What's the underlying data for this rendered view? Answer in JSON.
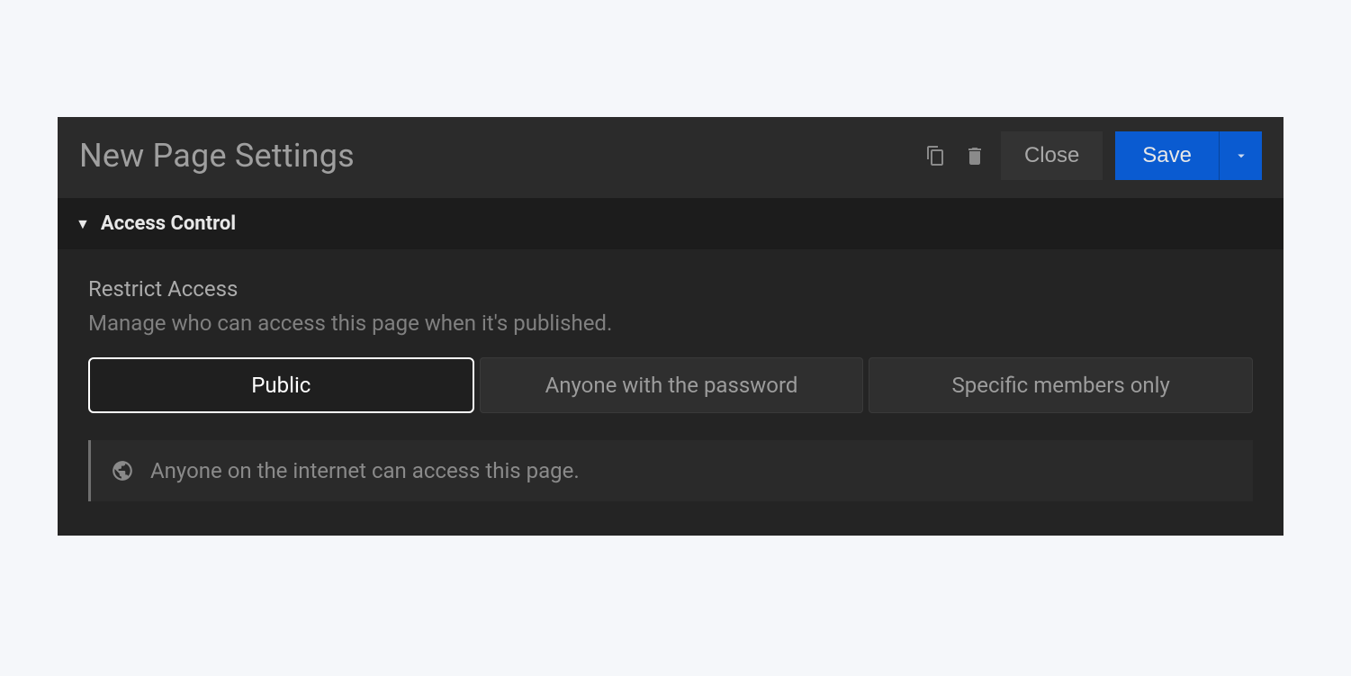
{
  "header": {
    "title": "New Page Settings",
    "close_label": "Close",
    "save_label": "Save"
  },
  "section": {
    "title": "Access Control"
  },
  "restrict": {
    "title": "Restrict Access",
    "desc": "Manage who can access this page when it's published.",
    "options": {
      "public": "Public",
      "password": "Anyone with the password",
      "members": "Specific members only"
    },
    "info": "Anyone on the internet can access this page."
  }
}
